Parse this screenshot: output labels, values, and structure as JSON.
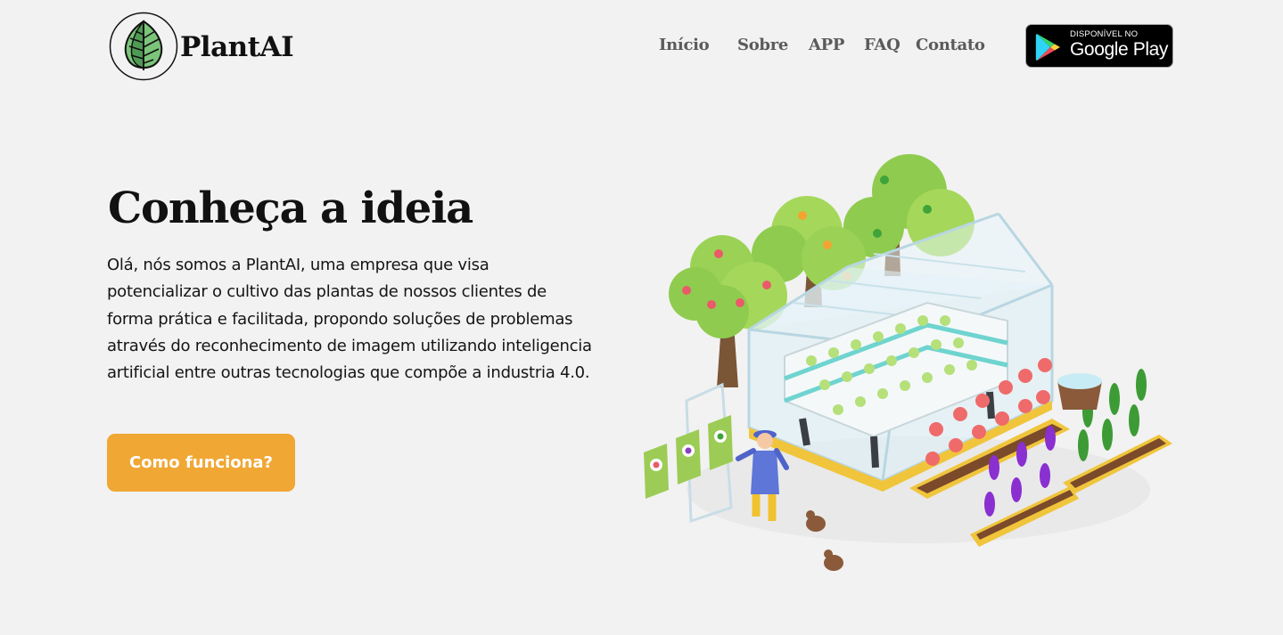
{
  "brand": {
    "name": "PlantAI",
    "logo_icon": "leaf-logo-icon",
    "accent_color": "#f0a734",
    "logo_green": "#7bc47a"
  },
  "nav": {
    "items": [
      {
        "label": "Início"
      },
      {
        "label": "Sobre"
      },
      {
        "label": "APP"
      },
      {
        "label": "FAQ"
      },
      {
        "label": "Contato"
      }
    ]
  },
  "store_badge": {
    "small_text": "DISPONÍVEL NO",
    "big_text": "Google Play",
    "icon": "google-play-icon"
  },
  "hero": {
    "title": "Conheça a ideia",
    "description": "Olá, nós somos a PlantAI, uma empresa que visa potencializar o cultivo das plantas de nossos clientes de forma prática e facilitada, propondo soluções de problemas através do reconhecimento de imagem utilizando inteligencia artificial entre outras tecnologias que compõe a industria 4.0.",
    "cta_label": "Como funciona?",
    "illustration": "smart-farm-illustration"
  }
}
